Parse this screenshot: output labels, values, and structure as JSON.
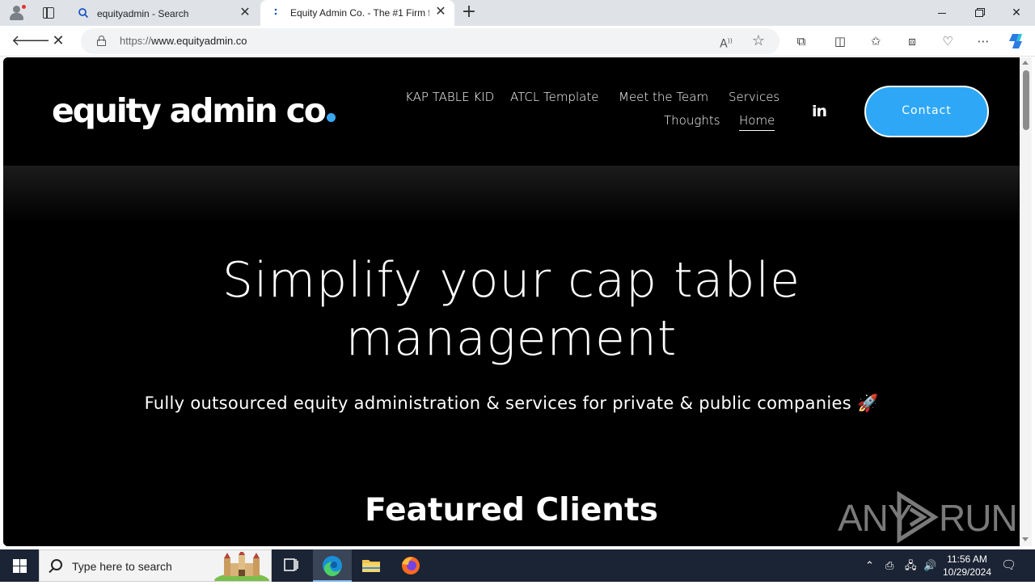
{
  "browser": {
    "tabs": [
      {
        "title": "equityadmin - Search",
        "active": false
      },
      {
        "title": "Equity Admin Co. - The #1 Firm f",
        "active": true
      }
    ],
    "address": {
      "scheme": "https://",
      "host": "www.equityadmin.co"
    }
  },
  "site": {
    "logo_text": "equity admin co",
    "nav": {
      "kap": "KAP TABLE KID",
      "atcl": "ATCL Template",
      "team": "Meet the Team",
      "services": "Services",
      "thoughts": "Thoughts",
      "home": "Home"
    },
    "linkedin": "in",
    "contact_label": "Contact",
    "hero": {
      "title_line1": "Simplify your cap table",
      "title_line2": "management",
      "subtitle": "Fully outsourced equity administration & services for private & public companies 🚀"
    },
    "featured_heading": "Featured Clients"
  },
  "watermark": {
    "left": "ANY",
    "right": "RUN"
  },
  "taskbar": {
    "search_placeholder": "Type here to search",
    "time": "11:56 AM",
    "date": "10/29/2024"
  },
  "colors": {
    "accent_blue": "#2ea8f6",
    "logo_dot": "#3aa8f5",
    "page_bg": "#000000",
    "taskbar_bg": "#1b2434"
  }
}
